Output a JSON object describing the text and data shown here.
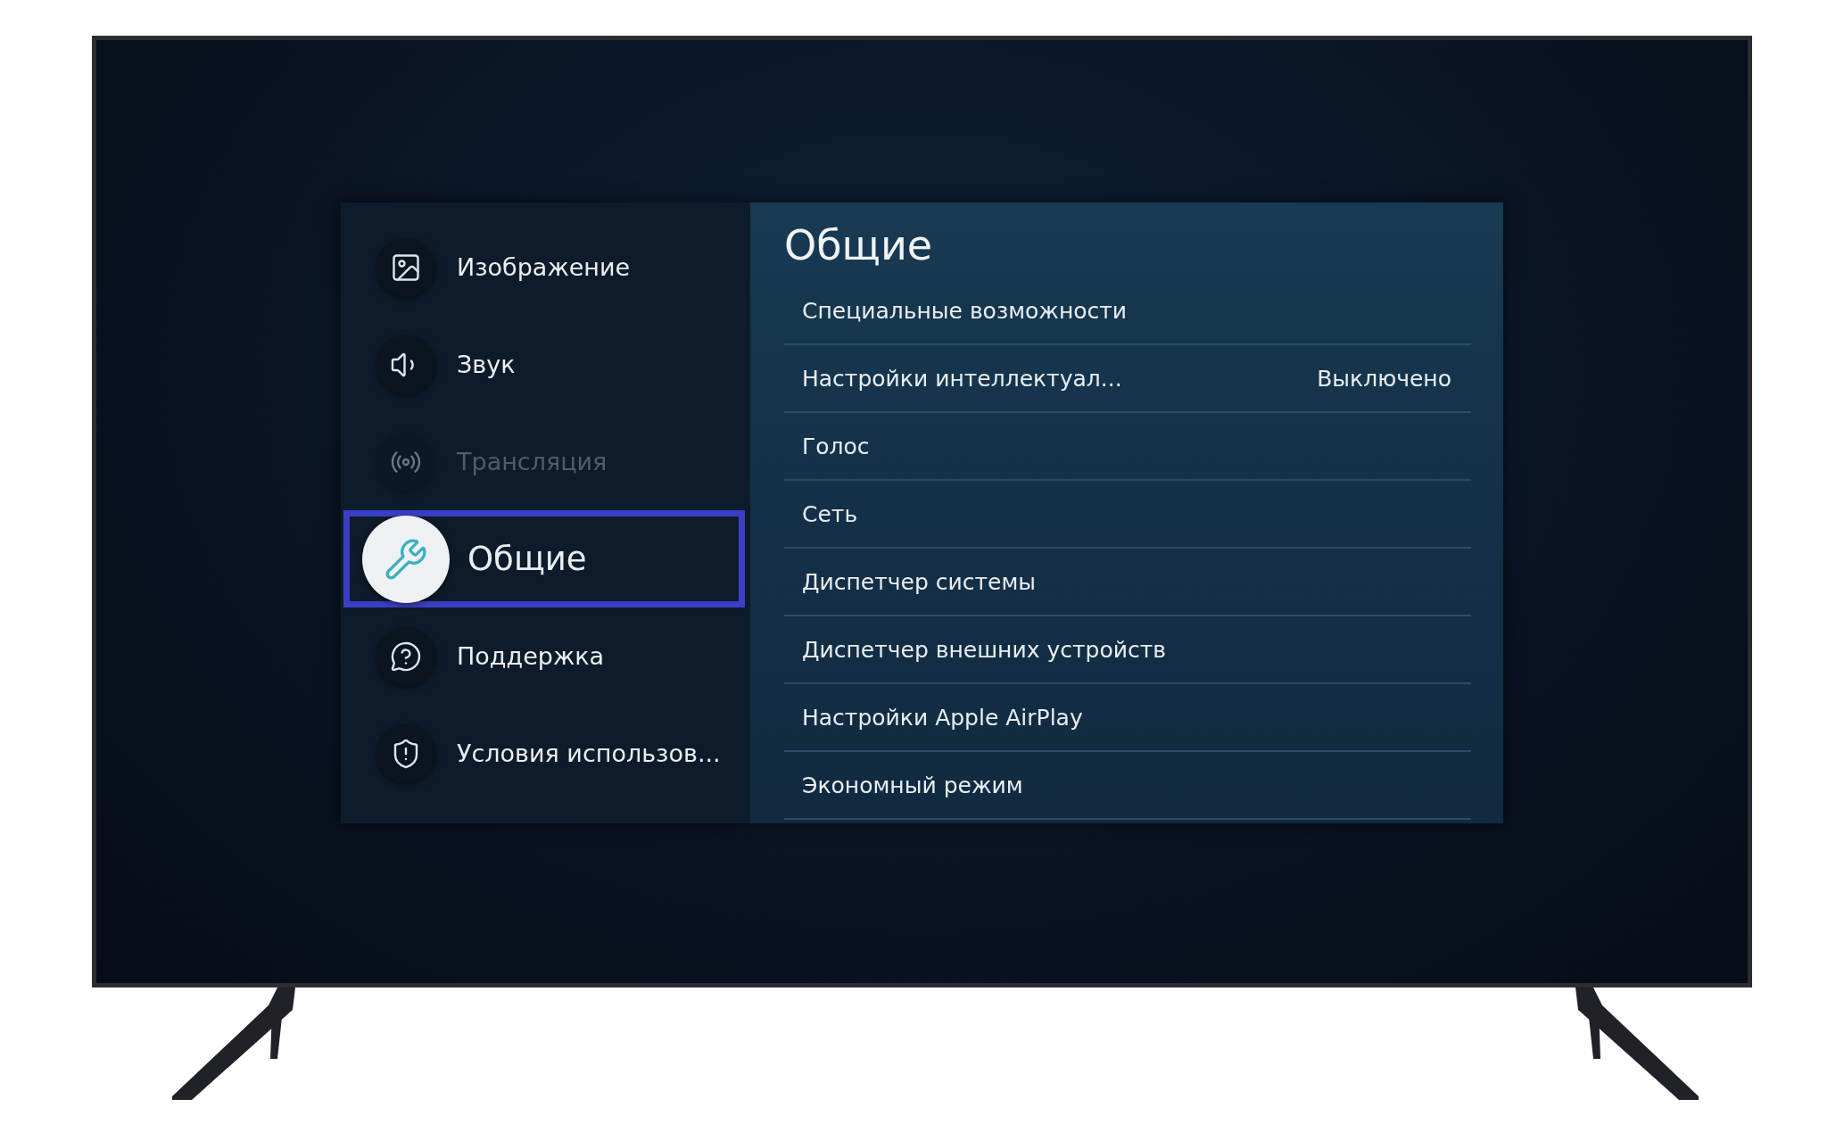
{
  "sidebar": {
    "items": [
      {
        "label": "Изображение",
        "kind": "picture",
        "selected": false,
        "disabled": false
      },
      {
        "label": "Звук",
        "kind": "sound",
        "selected": false,
        "disabled": false
      },
      {
        "label": "Трансляция",
        "kind": "broadcast",
        "selected": false,
        "disabled": true
      },
      {
        "label": "Общие",
        "kind": "general",
        "selected": true,
        "disabled": false
      },
      {
        "label": "Поддержка",
        "kind": "support",
        "selected": false,
        "disabled": false
      },
      {
        "label": "Условия использов...",
        "kind": "terms",
        "selected": false,
        "disabled": false
      }
    ]
  },
  "panel": {
    "title": "Общие",
    "items": [
      {
        "label": "Специальные возможности"
      },
      {
        "label": "Настройки интеллектуал...",
        "value": "Выключено"
      },
      {
        "label": "Голос"
      },
      {
        "label": "Сеть"
      },
      {
        "label": "Диспетчер системы"
      },
      {
        "label": "Диспетчер внешних устройств"
      },
      {
        "label": "Настройки Apple AirPlay"
      },
      {
        "label": "Экономный режим"
      }
    ]
  }
}
